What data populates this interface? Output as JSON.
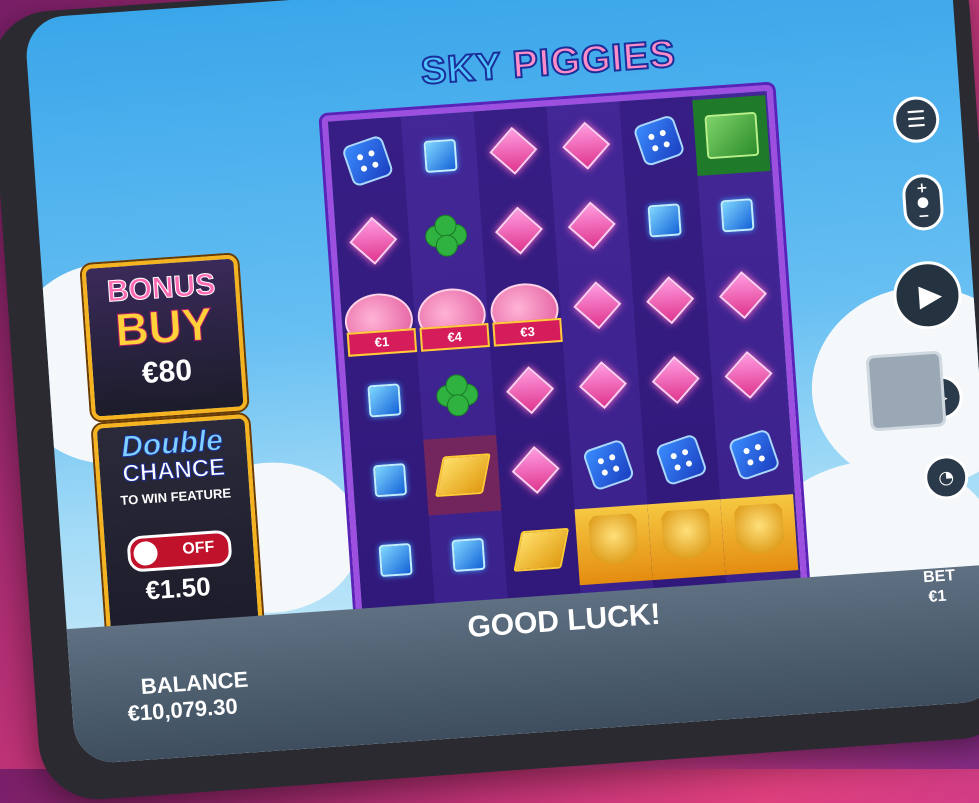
{
  "game": {
    "title_sky": "SKY",
    "title_piggies": "PIGGIES",
    "message": "GOOD LUCK!"
  },
  "bonus_buy": {
    "title_line1": "BONUS",
    "title_line2": "BUY",
    "price": "€80"
  },
  "double_chance": {
    "title_line1": "Double",
    "title_line2": "CHANCE",
    "subtitle": "TO WIN FEATURE",
    "toggle_state": "OFF",
    "price": "€1.50"
  },
  "footer": {
    "balance_label": "BALANCE",
    "balance_value": "€10,079.30",
    "bet_label": "BET",
    "bet_value": "€1"
  },
  "controls": {
    "menu_icon": "menu-icon",
    "bet_icon": "bet-adjust-icon",
    "spin_icon": "play-icon",
    "autoplay_icon": "autoplay-icon",
    "turbo_icon": "speedometer-icon"
  },
  "grid": {
    "columns": [
      [
        "dice",
        "gem-pink",
        "pig",
        "gem-blue",
        "gem-blue",
        "gem-blue"
      ],
      [
        "gem-blue",
        "clover",
        "pig",
        "clover",
        "gold",
        "gem-blue"
      ],
      [
        "gem-pink",
        "gem-pink",
        "pig",
        "gem-pink",
        "gem-pink",
        "gold"
      ],
      [
        "gem-pink",
        "gem-pink",
        "gem-pink",
        "gem-pink",
        "dice",
        "coinkey"
      ],
      [
        "dice",
        "gem-blue",
        "gem-pink",
        "gem-pink",
        "dice",
        "coinkey"
      ],
      [
        "cash",
        "gem-blue",
        "gem-pink",
        "gem-pink",
        "dice",
        "coinkey"
      ]
    ],
    "pig_values": [
      "€1",
      "€4",
      "€3"
    ]
  },
  "colors": {
    "accent_gold": "#f5b320",
    "reel_purple": "#4a2aa0",
    "toggle_red": "#c0122a"
  }
}
